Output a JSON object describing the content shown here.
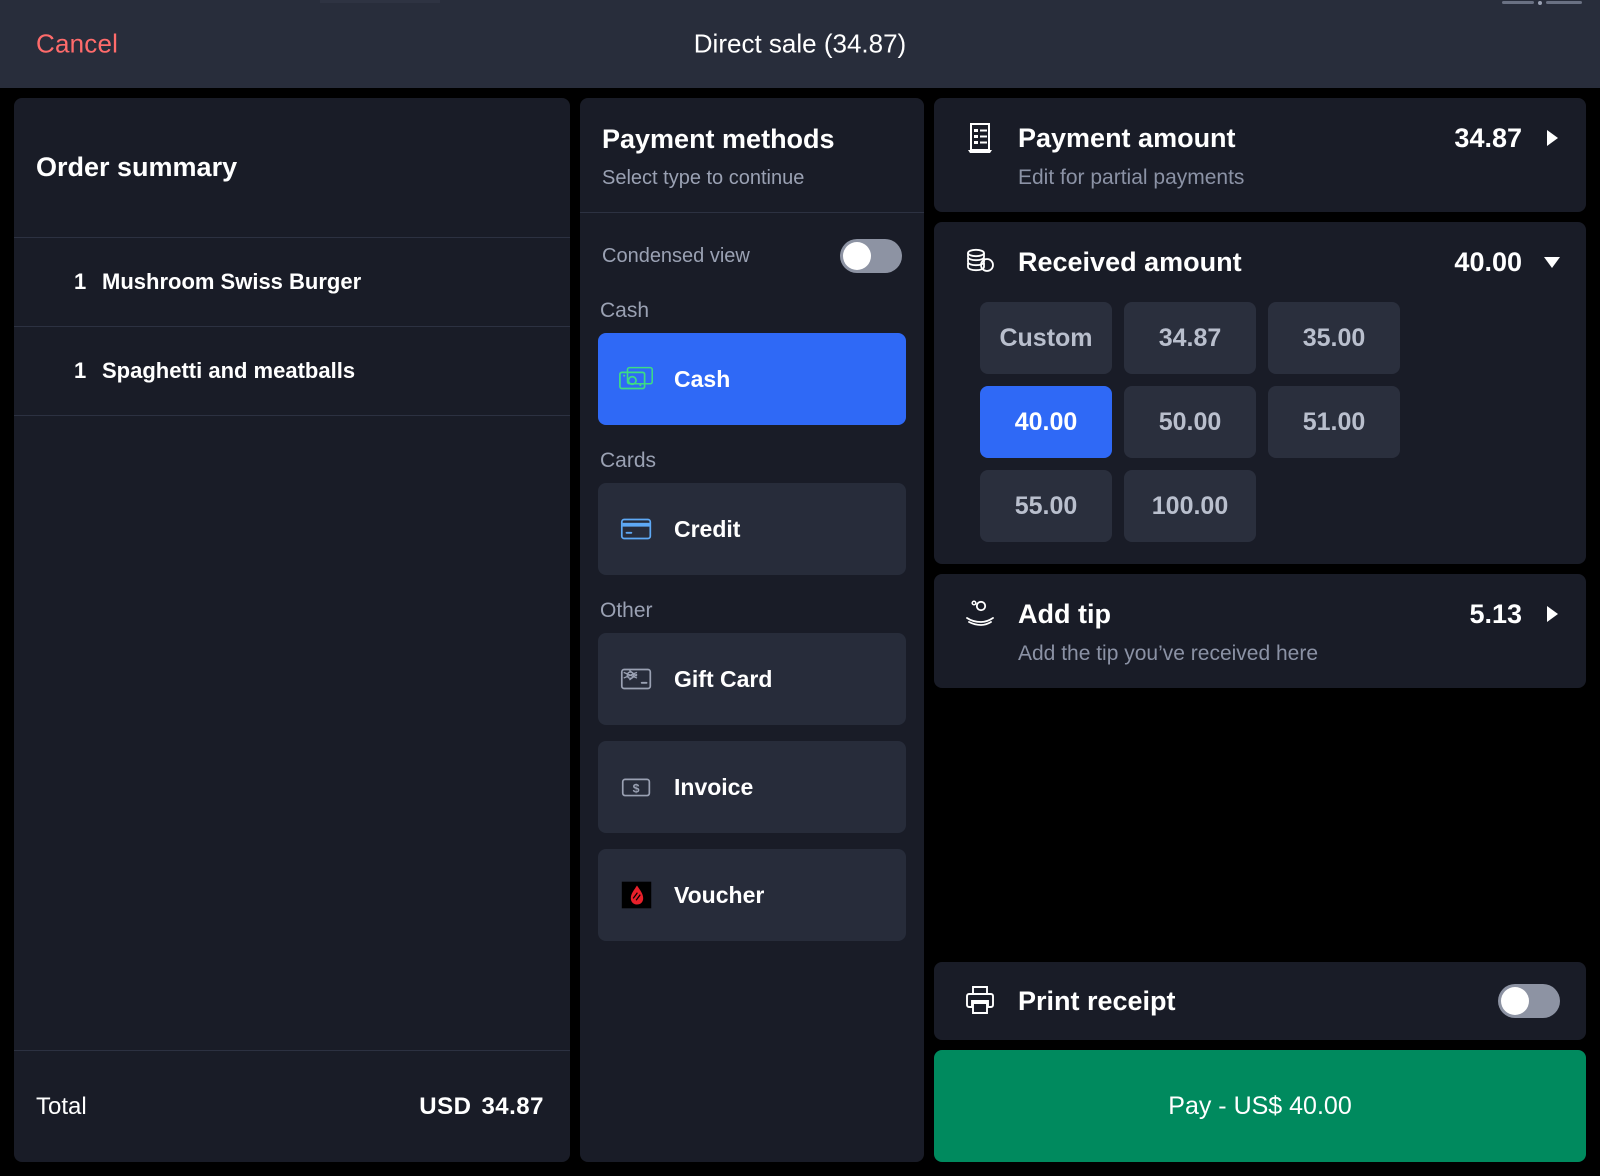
{
  "header": {
    "cancel_label": "Cancel",
    "title": "Direct sale (34.87)"
  },
  "order_summary": {
    "title": "Order summary",
    "items": [
      {
        "qty": "1",
        "name": "Mushroom Swiss Burger"
      },
      {
        "qty": "1",
        "name": "Spaghetti and meatballs"
      }
    ],
    "total_label": "Total",
    "total_currency": "USD",
    "total_value": "34.87"
  },
  "payment_methods": {
    "title": "Payment methods",
    "subtitle": "Select type to continue",
    "condensed_view_label": "Condensed view",
    "condensed_view_on": false,
    "sections": [
      {
        "label": "Cash",
        "items": [
          {
            "label": "Cash",
            "icon": "banknote-icon",
            "selected": true
          }
        ]
      },
      {
        "label": "Cards",
        "items": [
          {
            "label": "Credit",
            "icon": "credit-card-icon",
            "selected": false
          }
        ]
      },
      {
        "label": "Other",
        "items": [
          {
            "label": "Gift Card",
            "icon": "gift-card-icon",
            "selected": false
          },
          {
            "label": "Invoice",
            "icon": "invoice-dollar-icon",
            "selected": false
          },
          {
            "label": "Voucher",
            "icon": "voucher-flame-icon",
            "selected": false
          }
        ]
      }
    ]
  },
  "payment_amount": {
    "icon": "receipt-icon",
    "title": "Payment amount",
    "value": "34.87",
    "subtitle": "Edit for partial payments",
    "chevron": "chevron-right-icon"
  },
  "received_amount": {
    "icon": "coins-icon",
    "title": "Received amount",
    "value": "40.00",
    "chevron": "chevron-down-icon",
    "quick_amounts": [
      {
        "label": "Custom",
        "selected": false
      },
      {
        "label": "34.87",
        "selected": false
      },
      {
        "label": "35.00",
        "selected": false
      },
      {
        "label": "40.00",
        "selected": true
      },
      {
        "label": "50.00",
        "selected": false
      },
      {
        "label": "51.00",
        "selected": false
      },
      {
        "label": "55.00",
        "selected": false
      },
      {
        "label": "100.00",
        "selected": false
      }
    ]
  },
  "add_tip": {
    "icon": "tip-hand-icon",
    "title": "Add tip",
    "value": "5.13",
    "subtitle": "Add the tip you’ve received here",
    "chevron": "chevron-right-icon"
  },
  "print_receipt": {
    "icon": "printer-icon",
    "label": "Print receipt",
    "on": false
  },
  "pay_button": {
    "label": "Pay - US$ 40.00"
  },
  "colors": {
    "accent_blue": "#2f69f6",
    "pay_green": "#008a5e",
    "cancel_red": "#ff6b6b",
    "panel_bg": "#191c27",
    "header_bg": "#282d3b",
    "tile_bg": "#2a2f3d",
    "muted_text": "#9aa1b3"
  }
}
